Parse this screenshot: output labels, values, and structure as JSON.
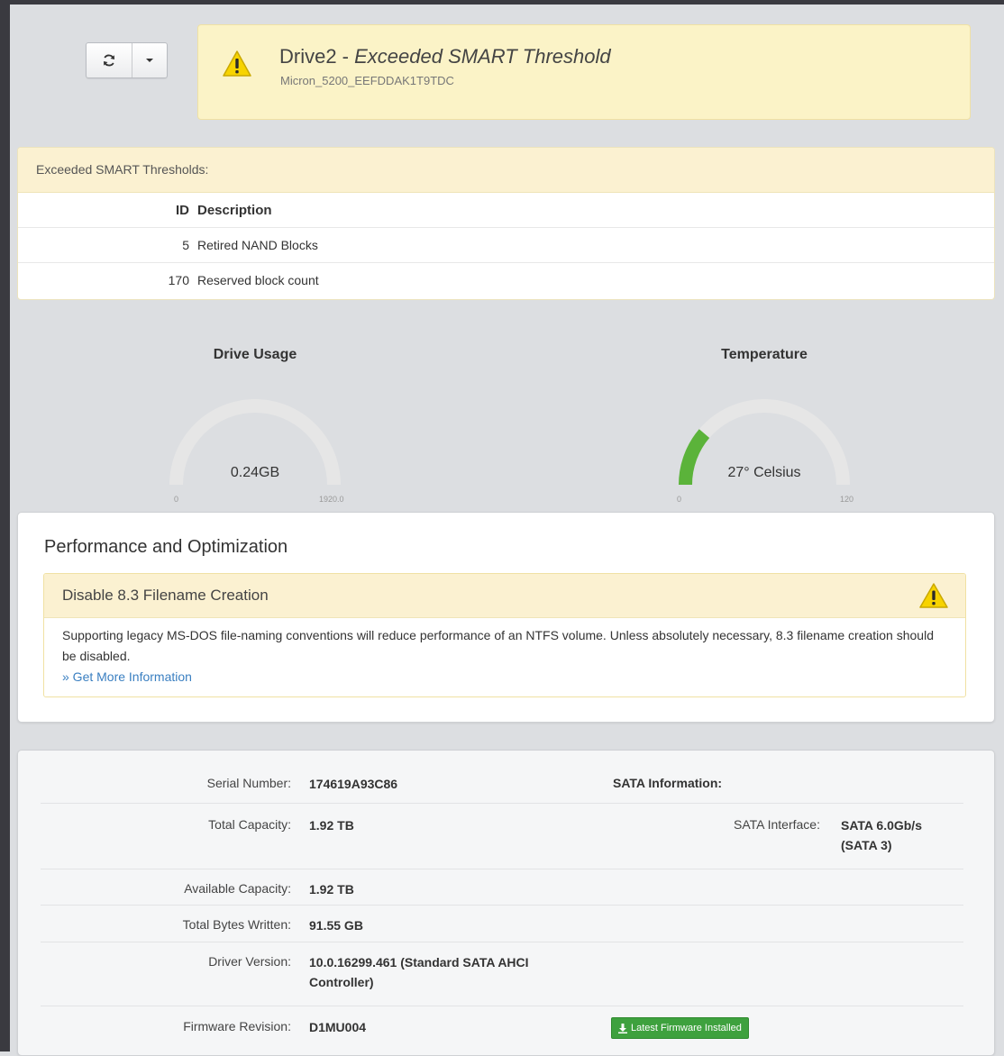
{
  "alert": {
    "drive_name": "Drive2 - ",
    "status": "Exceeded SMART Threshold",
    "model": "Micron_5200_EEFDDAK1T9TDC"
  },
  "thresholds": {
    "title": "Exceeded SMART Thresholds:",
    "columns": {
      "id": "ID",
      "description": "Description"
    },
    "rows": [
      {
        "id": "5",
        "description": "Retired NAND Blocks"
      },
      {
        "id": "170",
        "description": "Reserved block count"
      }
    ]
  },
  "gauges": {
    "usage": {
      "label": "Drive Usage",
      "value_text": "0.24GB",
      "value": 0.24,
      "min": "0",
      "max": "1920.0",
      "max_value": 1920.0
    },
    "temperature": {
      "label": "Temperature",
      "value_text": "27° Celsius",
      "value": 27,
      "min": "0",
      "max": "120",
      "max_value": 120,
      "fill_color": "#5bb33a"
    }
  },
  "performance": {
    "title": "Performance and Optimization",
    "card": {
      "title": "Disable 8.3 Filename Creation",
      "body": "Supporting legacy MS-DOS file-naming conventions will reduce performance of an NTFS volume. Unless absolutely necessary, 8.3 filename creation should be disabled.",
      "link": "» Get More Information"
    }
  },
  "details": {
    "serial": {
      "label": "Serial Number:",
      "value": "174619A93C86"
    },
    "total_capacity": {
      "label": "Total Capacity:",
      "value": "1.92 TB"
    },
    "available_capacity": {
      "label": "Available Capacity:",
      "value": "1.92 TB"
    },
    "bytes_written": {
      "label": "Total Bytes Written:",
      "value": "91.55 GB"
    },
    "driver": {
      "label": "Driver Version:",
      "value_line1": "10.0.16299.461 (Standard SATA AHCI",
      "value_line2": "Controller)"
    },
    "firmware": {
      "label": "Firmware Revision:",
      "value": "D1MU004",
      "badge": "Latest Firmware Installed"
    },
    "sata": {
      "heading": "SATA Information:",
      "interface_label": "SATA Interface:",
      "interface_line1": "SATA 6.0Gb/s",
      "interface_line2": "(SATA 3)"
    }
  },
  "colors": {
    "warning_yellow": "#fbf3c7",
    "success_green": "#3ea13e",
    "link_blue": "#3a7fc1"
  }
}
